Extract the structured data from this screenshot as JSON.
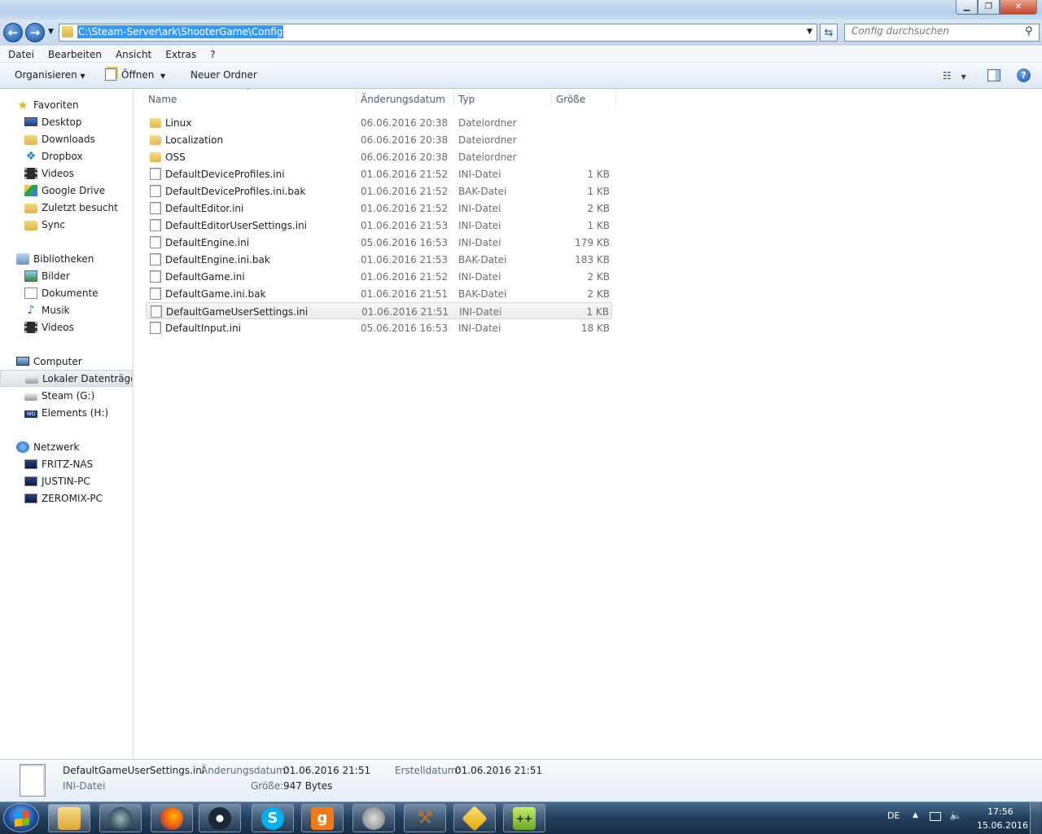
{
  "address": {
    "path": "C:\\Steam-Server\\ark\\ShooterGame\\Config"
  },
  "search": {
    "placeholder": "Config durchsuchen"
  },
  "menu": [
    "Datei",
    "Bearbeiten",
    "Ansicht",
    "Extras",
    "?"
  ],
  "toolbar": {
    "organize": "Organisieren",
    "open": "Öffnen",
    "new_folder": "Neuer Ordner"
  },
  "nav": {
    "favorites": {
      "label": "Favoriten",
      "items": [
        "Desktop",
        "Downloads",
        "Dropbox",
        "Videos",
        "Google Drive",
        "Zuletzt besucht",
        "Sync"
      ]
    },
    "libraries": {
      "label": "Bibliotheken",
      "items": [
        "Bilder",
        "Dokumente",
        "Musik",
        "Videos"
      ]
    },
    "computer": {
      "label": "Computer",
      "items": [
        "Lokaler Datenträger (",
        "Steam (G:)",
        "Elements (H:)"
      ]
    },
    "network": {
      "label": "Netzwerk",
      "items": [
        "FRITZ-NAS",
        "JUSTIN-PC",
        "ZEROMIX-PC"
      ]
    }
  },
  "columns": {
    "name": "Name",
    "date": "Änderungsdatum",
    "type": "Typ",
    "size": "Größe"
  },
  "files": [
    {
      "icon": "folder-icon",
      "name": "Linux",
      "date": "06.06.2016 20:38",
      "type": "Dateiordner",
      "size": ""
    },
    {
      "icon": "folder-icon",
      "name": "Localization",
      "date": "06.06.2016 20:38",
      "type": "Dateiordner",
      "size": ""
    },
    {
      "icon": "folder-icon",
      "name": "OSS",
      "date": "06.06.2016 20:38",
      "type": "Dateiordner",
      "size": ""
    },
    {
      "icon": "file-icon",
      "name": "DefaultDeviceProfiles.ini",
      "date": "01.06.2016 21:52",
      "type": "INI-Datei",
      "size": "1 KB"
    },
    {
      "icon": "file-icon",
      "name": "DefaultDeviceProfiles.ini.bak",
      "date": "01.06.2016 21:52",
      "type": "BAK-Datei",
      "size": "1 KB"
    },
    {
      "icon": "file-icon",
      "name": "DefaultEditor.ini",
      "date": "01.06.2016 21:52",
      "type": "INI-Datei",
      "size": "2 KB"
    },
    {
      "icon": "file-icon",
      "name": "DefaultEditorUserSettings.ini",
      "date": "01.06.2016 21:53",
      "type": "INI-Datei",
      "size": "1 KB"
    },
    {
      "icon": "file-icon",
      "name": "DefaultEngine.ini",
      "date": "05.06.2016 16:53",
      "type": "INI-Datei",
      "size": "179 KB"
    },
    {
      "icon": "file-icon",
      "name": "DefaultEngine.ini.bak",
      "date": "01.06.2016 21:53",
      "type": "BAK-Datei",
      "size": "183 KB"
    },
    {
      "icon": "file-icon",
      "name": "DefaultGame.ini",
      "date": "01.06.2016 21:52",
      "type": "INI-Datei",
      "size": "2 KB"
    },
    {
      "icon": "file-icon",
      "name": "DefaultGame.ini.bak",
      "date": "01.06.2016 21:51",
      "type": "BAK-Datei",
      "size": "2 KB"
    },
    {
      "icon": "file-icon",
      "name": "DefaultGameUserSettings.ini",
      "date": "01.06.2016 21:51",
      "type": "INI-Datei",
      "size": "1 KB",
      "selected": true
    },
    {
      "icon": "file-icon",
      "name": "DefaultInput.ini",
      "date": "05.06.2016 16:53",
      "type": "INI-Datei",
      "size": "18 KB"
    }
  ],
  "details": {
    "filename": "DefaultGameUserSettings.ini",
    "filetype": "INI-Datei",
    "modified_label": "Änderungsdatum:",
    "modified": "01.06.2016 21:51",
    "created_label": "Erstelldatum:",
    "created": "01.06.2016 21:51",
    "size_label": "Größe:",
    "size": "947 Bytes"
  },
  "taskbar": {
    "apps": [
      "explorer-icon",
      "steam-helper-icon",
      "firefox-icon",
      "steam-icon",
      "skype-icon",
      "gmod-icon",
      "speaker-app-icon",
      "gavel-icon",
      "cube-icon",
      "notepad-plus-icon"
    ],
    "lang": "DE",
    "time": "17:56",
    "date": "15.06.2016"
  },
  "colors": {
    "selection": "#3399ff",
    "taskbar": "#24415f"
  }
}
